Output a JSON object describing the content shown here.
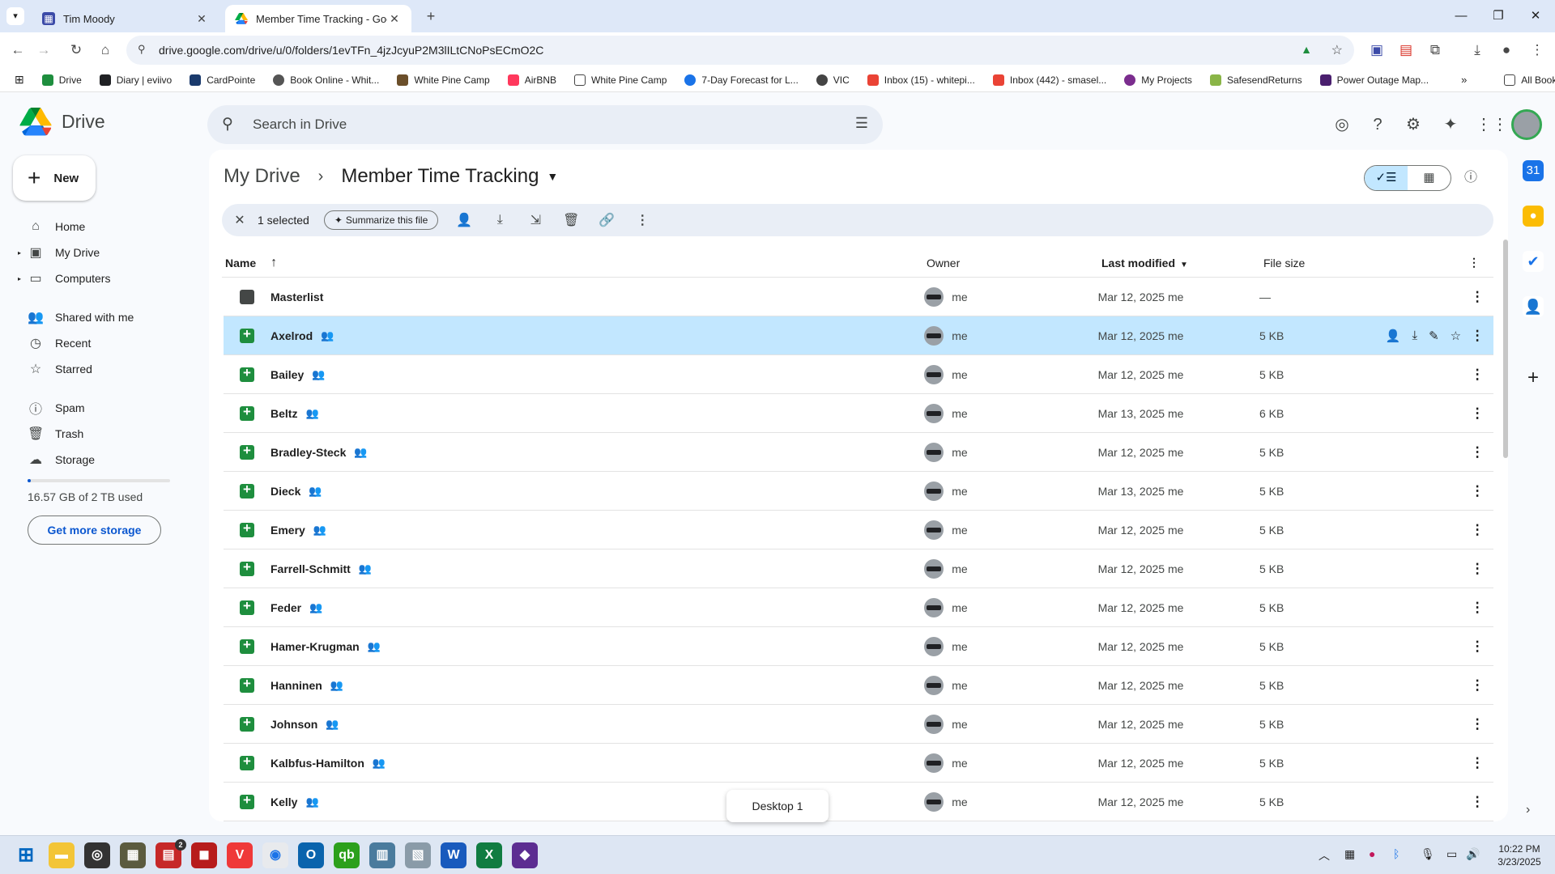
{
  "browser": {
    "tabs": [
      {
        "title": "Tim Moody",
        "active": false
      },
      {
        "title": "Member Time Tracking - Google",
        "active": true
      }
    ],
    "url": "drive.google.com/drive/u/0/folders/1evTFn_4jzJcyuP2M3lILtCNoPsECmO2C",
    "bookmarks": [
      "Drive",
      "Diary | eviivo",
      "CardPointe",
      "Book Online - Whit...",
      "White Pine Camp",
      "AirBNB",
      "White Pine Camp",
      "7-Day Forecast for L...",
      "VIC",
      "Inbox (15) - whitepi...",
      "Inbox (442) - smasel...",
      "My Projects",
      "SafesendReturns",
      "Power Outage Map..."
    ],
    "all_bookmarks": "All Bookmarks"
  },
  "drive": {
    "logo_text": "Drive",
    "search_placeholder": "Search in Drive",
    "new_label": "New",
    "nav": [
      {
        "label": "Home",
        "icon": "home-icon"
      },
      {
        "label": "My Drive",
        "icon": "my-drive-icon"
      },
      {
        "label": "Computers",
        "icon": "computers-icon"
      },
      {
        "label": "Shared with me",
        "icon": "shared-icon"
      },
      {
        "label": "Recent",
        "icon": "clock-icon"
      },
      {
        "label": "Starred",
        "icon": "star-icon"
      },
      {
        "label": "Spam",
        "icon": "spam-icon"
      },
      {
        "label": "Trash",
        "icon": "trash-icon"
      },
      {
        "label": "Storage",
        "icon": "cloud-icon"
      }
    ],
    "storage_used": "16.57 GB of 2 TB used",
    "storage_fraction": 0.008,
    "get_storage": "Get more storage",
    "breadcrumb": {
      "root": "My Drive",
      "current": "Member Time Tracking"
    },
    "selection": {
      "count_label": "1 selected",
      "summarize": "Summarize this file"
    },
    "columns": {
      "name": "Name",
      "owner": "Owner",
      "modified": "Last modified",
      "size": "File size"
    },
    "files": [
      {
        "name": "Masterlist",
        "type": "folder",
        "shared": false,
        "owner": "me",
        "modified": "Mar 12, 2025 me",
        "size": "—",
        "selected": false
      },
      {
        "name": "Axelrod",
        "type": "sheet",
        "shared": true,
        "owner": "me",
        "modified": "Mar 12, 2025 me",
        "size": "5 KB",
        "selected": true
      },
      {
        "name": "Bailey",
        "type": "sheet",
        "shared": true,
        "owner": "me",
        "modified": "Mar 12, 2025 me",
        "size": "5 KB",
        "selected": false
      },
      {
        "name": "Beltz",
        "type": "sheet",
        "shared": true,
        "owner": "me",
        "modified": "Mar 13, 2025 me",
        "size": "6 KB",
        "selected": false
      },
      {
        "name": "Bradley-Steck",
        "type": "sheet",
        "shared": true,
        "owner": "me",
        "modified": "Mar 12, 2025 me",
        "size": "5 KB",
        "selected": false
      },
      {
        "name": "Dieck",
        "type": "sheet",
        "shared": true,
        "owner": "me",
        "modified": "Mar 13, 2025 me",
        "size": "5 KB",
        "selected": false
      },
      {
        "name": "Emery",
        "type": "sheet",
        "shared": true,
        "owner": "me",
        "modified": "Mar 12, 2025 me",
        "size": "5 KB",
        "selected": false
      },
      {
        "name": "Farrell-Schmitt",
        "type": "sheet",
        "shared": true,
        "owner": "me",
        "modified": "Mar 12, 2025 me",
        "size": "5 KB",
        "selected": false
      },
      {
        "name": "Feder",
        "type": "sheet",
        "shared": true,
        "owner": "me",
        "modified": "Mar 12, 2025 me",
        "size": "5 KB",
        "selected": false
      },
      {
        "name": "Hamer-Krugman",
        "type": "sheet",
        "shared": true,
        "owner": "me",
        "modified": "Mar 12, 2025 me",
        "size": "5 KB",
        "selected": false
      },
      {
        "name": "Hanninen",
        "type": "sheet",
        "shared": true,
        "owner": "me",
        "modified": "Mar 12, 2025 me",
        "size": "5 KB",
        "selected": false
      },
      {
        "name": "Johnson",
        "type": "sheet",
        "shared": true,
        "owner": "me",
        "modified": "Mar 12, 2025 me",
        "size": "5 KB",
        "selected": false
      },
      {
        "name": "Kalbfus-Hamilton",
        "type": "sheet",
        "shared": true,
        "owner": "me",
        "modified": "Mar 12, 2025 me",
        "size": "5 KB",
        "selected": false
      },
      {
        "name": "Kelly",
        "type": "sheet",
        "shared": true,
        "owner": "me",
        "modified": "Mar 12, 2025 me",
        "size": "5 KB",
        "selected": false
      }
    ],
    "desktop_tooltip": "Desktop 1"
  },
  "taskbar": {
    "time": "10:22 PM",
    "date": "3/23/2025",
    "badge": "2"
  },
  "colors": {
    "accent": "#0b57d0",
    "selected_row": "#c2e7ff",
    "sheet_green": "#1e8e3e"
  }
}
